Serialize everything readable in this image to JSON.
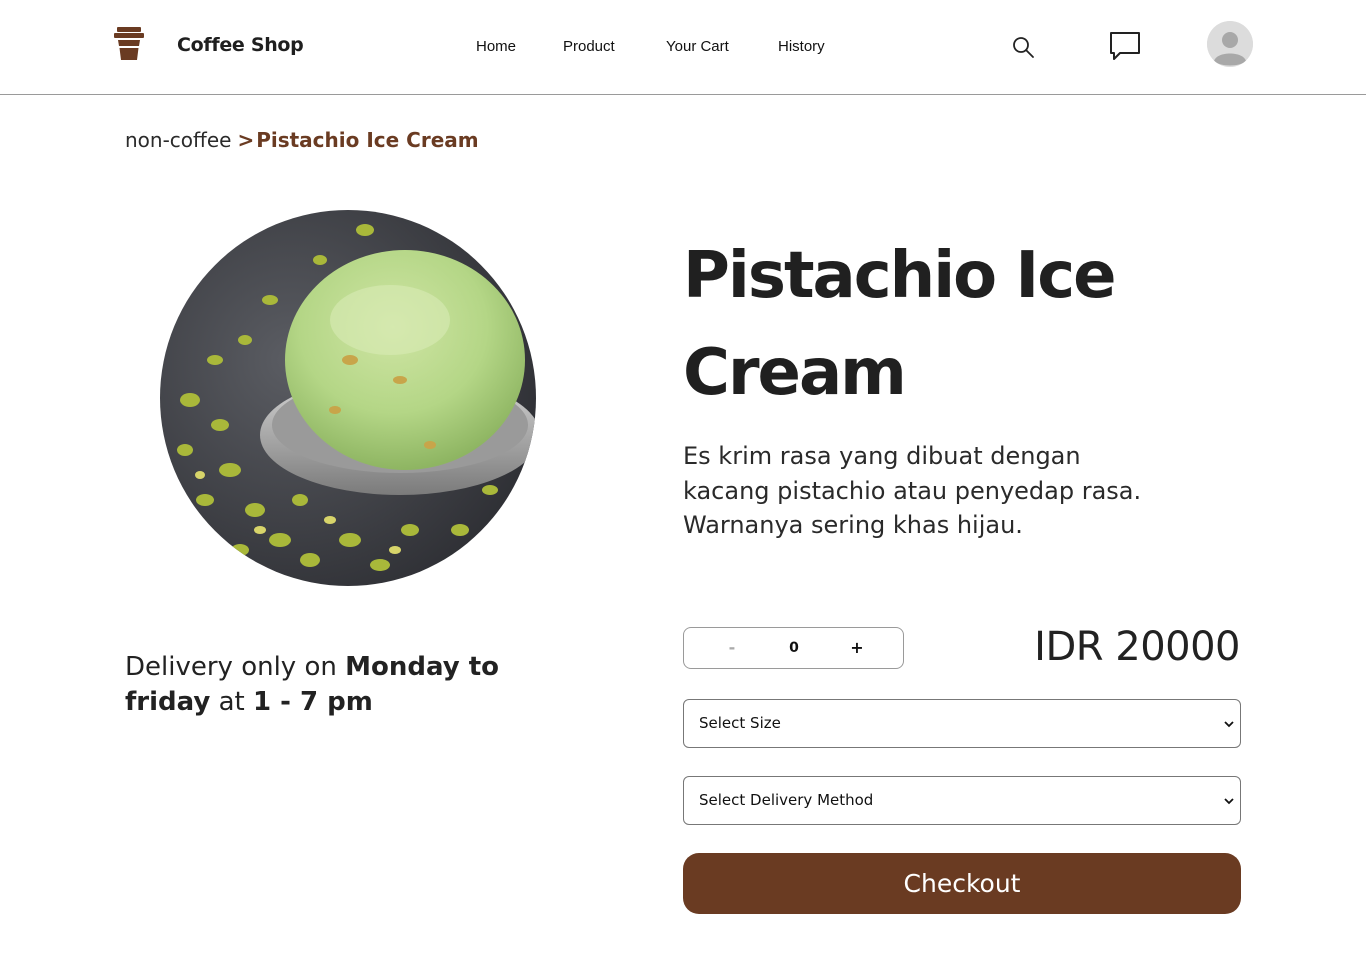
{
  "brand": {
    "name": "Coffee Shop",
    "color": "#6a3b22",
    "logo_icon": "coffee-cup-icon"
  },
  "nav": {
    "links": [
      {
        "label": "Home"
      },
      {
        "label": "Product"
      },
      {
        "label": "Your Cart"
      },
      {
        "label": "History"
      }
    ],
    "icons": [
      "search-icon",
      "chat-icon",
      "avatar-icon"
    ]
  },
  "breadcrumb": {
    "parent": "non-coffee",
    "separator": ">",
    "current": "Pistachio Ice Cream"
  },
  "product": {
    "title": "Pistachio Ice Cream",
    "description": "Es krim rasa yang dibuat dengan kacang pistachio atau penyedap rasa. Warnanya sering khas hijau.",
    "price": "IDR 20000",
    "image_alt": "pistachio ice cream scoop"
  },
  "delivery": {
    "prefix": "Delivery only on ",
    "days": "Monday to friday",
    "middle": " at ",
    "hours": "1 - 7 pm"
  },
  "quantity": {
    "minus": "-",
    "value": "0",
    "plus": "+"
  },
  "selects": {
    "size": "Select Size",
    "delivery_method": "Select Delivery Method"
  },
  "checkout": {
    "label": "Checkout"
  },
  "colors": {
    "accent": "#6a3b22",
    "text": "#202020"
  }
}
